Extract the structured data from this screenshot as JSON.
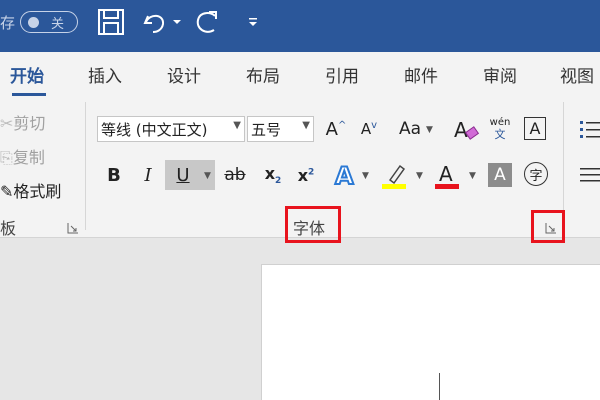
{
  "quick_access": {
    "autosave_label": "存",
    "autosave_state": "关"
  },
  "tabs": [
    "开始",
    "插入",
    "设计",
    "布局",
    "引用",
    "邮件",
    "审阅",
    "视图"
  ],
  "active_tab": "开始",
  "clipboard": {
    "cut": "剪切",
    "copy": "复制",
    "format_painter": "格式刷",
    "group_label": "板"
  },
  "font": {
    "font_name": "等线 (中文正文)",
    "font_size": "五号",
    "change_case": "Aa",
    "phonetic_top": "wén",
    "phonetic_bottom": "文",
    "char_border": "A",
    "group_label": "字体"
  },
  "colors": {
    "accent": "#2b579a",
    "highlight": "#ffff00",
    "font_color": "#e8131d",
    "callout": "#e8131d"
  }
}
